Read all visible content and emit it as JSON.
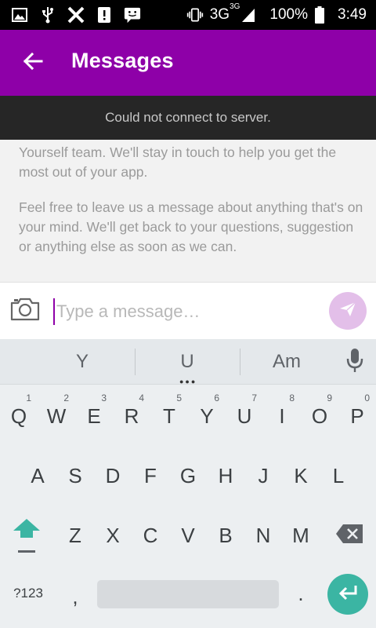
{
  "status_bar": {
    "icons_left": [
      "image-icon",
      "usb-icon",
      "x-icon",
      "alert-icon",
      "chat-icon"
    ],
    "vibrate_icon": "vibrate-icon",
    "network": "3G",
    "network_sup": "3G",
    "battery": "100%",
    "time": "3:49"
  },
  "app_bar": {
    "title": "Messages",
    "back_icon": "arrow-back-icon",
    "color": "#8e00a8"
  },
  "banner": {
    "text": "Could not connect to server."
  },
  "messages": {
    "paragraphs": [
      "Yourself team. We'll stay in touch to help you get the most out of your app.",
      "Feel free to leave us a message about anything that's on your mind. We'll get back to your questions, suggestion or anything else as soon as we can."
    ]
  },
  "composer": {
    "placeholder": "Type a message…",
    "value": "",
    "send_color": "#e3bfe9"
  },
  "keyboard": {
    "suggestions": [
      "Y",
      "U",
      "Am"
    ],
    "row1": [
      {
        "key": "Q",
        "hint": "1"
      },
      {
        "key": "W",
        "hint": "2"
      },
      {
        "key": "E",
        "hint": "3"
      },
      {
        "key": "R",
        "hint": "4"
      },
      {
        "key": "T",
        "hint": "5"
      },
      {
        "key": "Y",
        "hint": "6"
      },
      {
        "key": "U",
        "hint": "7"
      },
      {
        "key": "I",
        "hint": "8"
      },
      {
        "key": "O",
        "hint": "9"
      },
      {
        "key": "P",
        "hint": "0"
      }
    ],
    "row2": [
      "A",
      "S",
      "D",
      "F",
      "G",
      "H",
      "J",
      "K",
      "L"
    ],
    "row3": [
      "Z",
      "X",
      "C",
      "V",
      "B",
      "N",
      "M"
    ],
    "symbols_key": "?123",
    "comma_key": ",",
    "period_key": ".",
    "enter_color": "#3bb5a3",
    "shift_color": "#3bb5a3"
  }
}
